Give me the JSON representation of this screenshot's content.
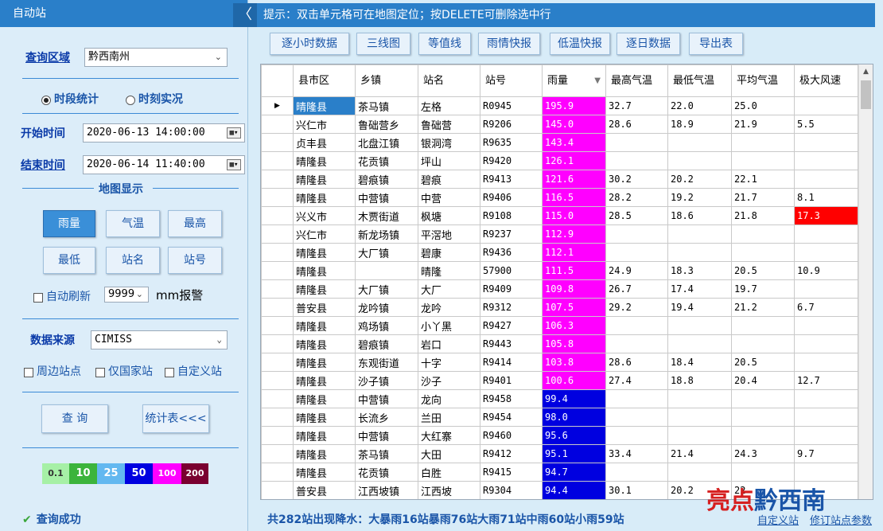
{
  "left": {
    "title": "自动站",
    "region_label": "查询区域",
    "region_value": "黔西南州",
    "radio_period": "时段统计",
    "radio_instant": "时刻实况",
    "start_label": "开始时间",
    "start_value": "2020-06-13 14:00:00",
    "end_label": "结束时间",
    "end_value": "2020-06-14 11:40:00",
    "map_display": "地图显示",
    "map_buttons": [
      "雨量",
      "气温",
      "最高",
      "最低",
      "站名",
      "站号"
    ],
    "auto_refresh": "自动刷新",
    "alarm_value": "9999",
    "alarm_unit": "mm报警",
    "source_label": "数据来源",
    "source_value": "CIMISS",
    "chk_nearby": "周边站点",
    "chk_national": "仅国家站",
    "chk_custom": "自定义站",
    "query_button": "查  询",
    "stats_button": "统计表<<<",
    "legend": [
      {
        "label": "0.1",
        "color": "#a6f0a6"
      },
      {
        "label": "10",
        "color": "#3cb43c"
      },
      {
        "label": "25",
        "color": "#63b8f0"
      },
      {
        "label": "50",
        "color": "#0000e0"
      },
      {
        "label": "100",
        "color": "#ff00ff"
      },
      {
        "label": "200",
        "color": "#7a0030"
      }
    ],
    "status": "查询成功"
  },
  "topbar": {
    "hint": "提示：双击单元格可在地图定位；按DELETE可删除选中行",
    "collapse": "〈"
  },
  "toolbar": [
    "逐小时数据",
    "三线图",
    "等值线",
    "雨情快报",
    "低温快报",
    "逐日数据",
    "导出表"
  ],
  "table": {
    "columns": [
      "",
      "县市区",
      "乡镇",
      "站名",
      "站号",
      "雨量",
      "最高气温",
      "最低气温",
      "平均气温",
      "极大风速"
    ],
    "rows": [
      [
        "晴隆县",
        "茶马镇",
        "左格",
        "R0945",
        "195.9",
        "32.7",
        "22.0",
        "25.0",
        ""
      ],
      [
        "兴仁市",
        "鲁础营乡",
        "鲁础营",
        "R9206",
        "145.0",
        "28.6",
        "18.9",
        "21.9",
        "5.5"
      ],
      [
        "贞丰县",
        "北盘江镇",
        "银洞湾",
        "R9635",
        "143.4",
        "",
        "",
        "",
        ""
      ],
      [
        "晴隆县",
        "花贡镇",
        "坪山",
        "R9420",
        "126.1",
        "",
        "",
        "",
        ""
      ],
      [
        "晴隆县",
        "碧痕镇",
        "碧痕",
        "R9413",
        "121.6",
        "30.2",
        "20.2",
        "22.1",
        ""
      ],
      [
        "晴隆县",
        "中营镇",
        "中营",
        "R9406",
        "116.5",
        "28.2",
        "19.2",
        "21.7",
        "8.1"
      ],
      [
        "兴义市",
        "木贾街道",
        "枫塘",
        "R9108",
        "115.0",
        "28.5",
        "18.6",
        "21.8",
        "17.3"
      ],
      [
        "兴仁市",
        "新龙场镇",
        "平滘地",
        "R9237",
        "112.9",
        "",
        "",
        "",
        ""
      ],
      [
        "晴隆县",
        "大厂镇",
        "碧康",
        "R9436",
        "112.1",
        "",
        "",
        "",
        ""
      ],
      [
        "晴隆县",
        "",
        "晴隆",
        "57900",
        "111.5",
        "24.9",
        "18.3",
        "20.5",
        "10.9"
      ],
      [
        "晴隆县",
        "大厂镇",
        "大厂",
        "R9409",
        "109.8",
        "26.7",
        "17.4",
        "19.7",
        ""
      ],
      [
        "普安县",
        "龙吟镇",
        "龙吟",
        "R9312",
        "107.5",
        "29.2",
        "19.4",
        "21.2",
        "6.7"
      ],
      [
        "晴隆县",
        "鸡场镇",
        "小丫黑",
        "R9427",
        "106.3",
        "",
        "",
        "",
        ""
      ],
      [
        "晴隆县",
        "碧痕镇",
        "岩口",
        "R9443",
        "105.8",
        "",
        "",
        "",
        ""
      ],
      [
        "晴隆县",
        "东观街道",
        "十字",
        "R9414",
        "103.8",
        "28.6",
        "18.4",
        "20.5",
        ""
      ],
      [
        "晴隆县",
        "沙子镇",
        "沙子",
        "R9401",
        "100.6",
        "27.4",
        "18.8",
        "20.4",
        "12.7"
      ],
      [
        "晴隆县",
        "中营镇",
        "龙向",
        "R9458",
        "99.4",
        "",
        "",
        "",
        ""
      ],
      [
        "晴隆县",
        "长流乡",
        "兰田",
        "R9454",
        "98.0",
        "",
        "",
        "",
        ""
      ],
      [
        "晴隆县",
        "中营镇",
        "大红寨",
        "R9460",
        "95.6",
        "",
        "",
        "",
        ""
      ],
      [
        "晴隆县",
        "茶马镇",
        "大田",
        "R9412",
        "95.1",
        "33.4",
        "21.4",
        "24.3",
        "9.7"
      ],
      [
        "晴隆县",
        "花贡镇",
        "白胜",
        "R9415",
        "94.7",
        "",
        "",
        "",
        ""
      ],
      [
        "普安县",
        "江西坡镇",
        "江西坡",
        "R9304",
        "94.4",
        "30.1",
        "20.2",
        "22",
        ""
      ]
    ]
  },
  "summary": "共282站出现降水：大暴雨16站暴雨76站大雨71站中雨60站小雨59站",
  "bottom_links": [
    "自定义站",
    "修订站点参数"
  ],
  "logo": {
    "red": "亮点",
    "blue": "黔西南"
  }
}
